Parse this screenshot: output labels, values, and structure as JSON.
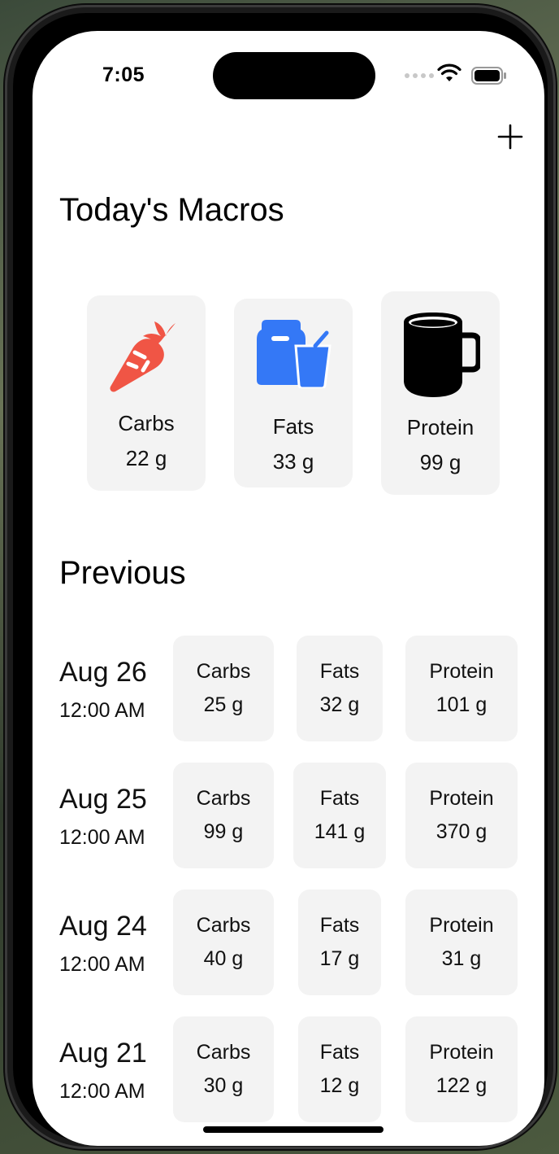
{
  "status": {
    "time": "7:05"
  },
  "header": {
    "title": "Today's Macros"
  },
  "today": [
    {
      "label": "Carbs",
      "value": "22 g",
      "icon": "carrot-icon"
    },
    {
      "label": "Fats",
      "value": "33 g",
      "icon": "food-drink-icon"
    },
    {
      "label": "Protein",
      "value": "99 g",
      "icon": "mug-icon"
    }
  ],
  "previous": {
    "title": "Previous",
    "entries": [
      {
        "date": "Aug 26",
        "time": "12:00 AM",
        "carbs_label": "Carbs",
        "carbs": "25 g",
        "fats_label": "Fats",
        "fats": "32 g",
        "protein_label": "Protein",
        "protein": "101 g"
      },
      {
        "date": "Aug 25",
        "time": "12:00 AM",
        "carbs_label": "Carbs",
        "carbs": "99 g",
        "fats_label": "Fats",
        "fats": "141 g",
        "protein_label": "Protein",
        "protein": "370 g"
      },
      {
        "date": "Aug 24",
        "time": "12:00 AM",
        "carbs_label": "Carbs",
        "carbs": "40 g",
        "fats_label": "Fats",
        "fats": "17 g",
        "protein_label": "Protein",
        "protein": "31 g"
      },
      {
        "date": "Aug 21",
        "time": "12:00 AM",
        "carbs_label": "Carbs",
        "carbs": "30 g",
        "fats_label": "Fats",
        "fats": "12 g",
        "protein_label": "Protein",
        "protein": "122 g"
      }
    ]
  },
  "colors": {
    "carrot": "#f05545",
    "fats": "#3478f6",
    "card_bg": "#f3f3f3"
  }
}
